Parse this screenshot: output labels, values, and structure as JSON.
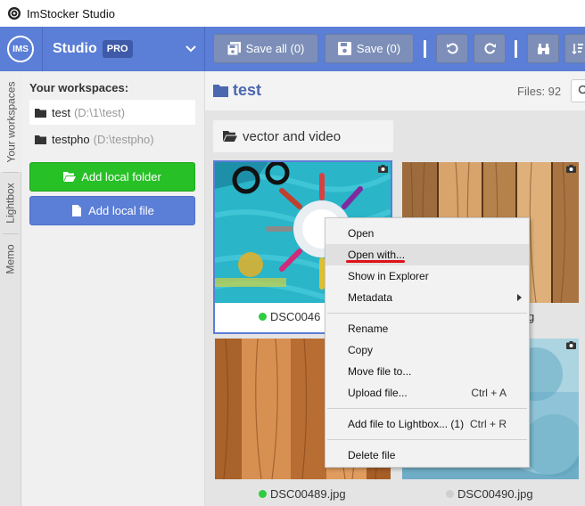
{
  "window": {
    "title": "ImStocker Studio"
  },
  "header": {
    "logo_text": "IMS",
    "brand": "Studio",
    "badge": "PRO",
    "save_all_label": "Save all (0)",
    "save_label": "Save (0)"
  },
  "tabs": [
    "Your workspaces",
    "Lightbox",
    "Memo"
  ],
  "workspaces": {
    "heading": "Your workspaces:",
    "items": [
      {
        "name": "test",
        "path": "(D:\\1\\test)"
      },
      {
        "name": "testpho",
        "path": "(D:\\testpho)"
      }
    ],
    "add_folder_label": "Add local folder",
    "add_file_label": "Add local file"
  },
  "main": {
    "folder_title": "test",
    "files_count": "Files: 92",
    "subfolder": "vector and video",
    "files": [
      {
        "name": "DSC0046",
        "status_color": "#2ecc40"
      },
      {
        "name": "g",
        "status_color": ""
      },
      {
        "name": "DSC00489.jpg",
        "status_color": "#2ecc40"
      },
      {
        "name": "DSC00490.jpg",
        "status_color": "#cfcfcf"
      }
    ]
  },
  "context_menu": {
    "items": [
      {
        "label": "Open"
      },
      {
        "label": "Open with..."
      },
      {
        "label": "Show in Explorer"
      },
      {
        "label": "Metadata"
      },
      {
        "label": "Rename"
      },
      {
        "label": "Copy"
      },
      {
        "label": "Move file to..."
      },
      {
        "label": "Upload file...",
        "shortcut": "Ctrl + A"
      },
      {
        "label": "Add file to Lightbox... (1)",
        "shortcut": "Ctrl + R"
      },
      {
        "label": "Delete file"
      }
    ]
  },
  "colors": {
    "header_blue": "#5b7ed6",
    "green_button": "#27c027",
    "status_green": "#2ecc40",
    "highlight_underline": "#e0101a"
  }
}
